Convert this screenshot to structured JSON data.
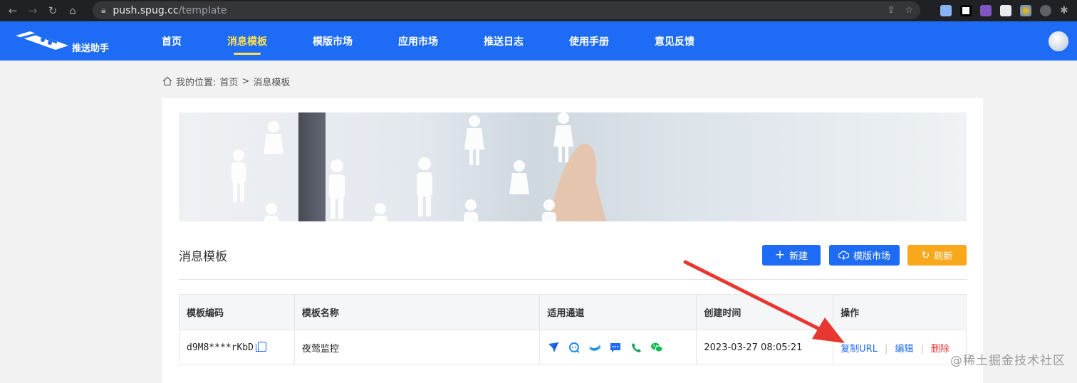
{
  "browser": {
    "url_host": "push.spug.cc",
    "url_path": "/template"
  },
  "app": {
    "name": "推送助手",
    "menu": [
      {
        "label": "首页"
      },
      {
        "label": "消息模板",
        "active": true
      },
      {
        "label": "模版市场"
      },
      {
        "label": "应用市场"
      },
      {
        "label": "推送日志"
      },
      {
        "label": "使用手册"
      },
      {
        "label": "意见反馈"
      }
    ],
    "brand_color": "#1e6cf5",
    "active_color": "#ffe14d"
  },
  "breadcrumb": {
    "prefix": "我的位置:",
    "home": "首页",
    "separator": ">",
    "current": "消息模板"
  },
  "section": {
    "title": "消息模板",
    "new_label": "新建",
    "market_label": "模版市场",
    "refresh_label": "刷新"
  },
  "table": {
    "headers": [
      "模板编码",
      "模板名称",
      "适用通道",
      "创建时间",
      "操作"
    ],
    "rows": [
      {
        "code": "d9M8****rKbD",
        "name": "夜莺监控",
        "channels": [
          "feishu-icon",
          "dingtalk-icon",
          "email-icon",
          "sms-icon",
          "phone-icon",
          "wechat-icon"
        ],
        "created": "2023-03-27 08:05:21",
        "actions": {
          "copy": "复制URL",
          "edit": "编辑",
          "delete": "删除"
        }
      }
    ]
  },
  "watermark": "@稀土掘金技术社区"
}
